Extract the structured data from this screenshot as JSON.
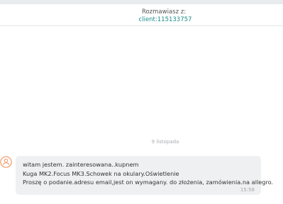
{
  "header": {
    "conversation_label": "Rozmawiasz z:",
    "client_id": "client:115133757"
  },
  "chat": {
    "date_separator": "9 listopada",
    "messages": [
      {
        "lines": [
          "witam jestem. zainteresowana..kupnem",
          "Kuga MK2.Focus MK3.Schowek na okulary.Oświetlenie",
          "Proszę o podanie.adresu email,jest on wymagany. do złożenia, zamówienia.na allegro."
        ],
        "time": "15:58",
        "avatar_icon": "user-icon"
      }
    ]
  },
  "colors": {
    "accent": "#1c8c8a",
    "avatar": "#f0915a",
    "bubble": "#eef0f2"
  }
}
